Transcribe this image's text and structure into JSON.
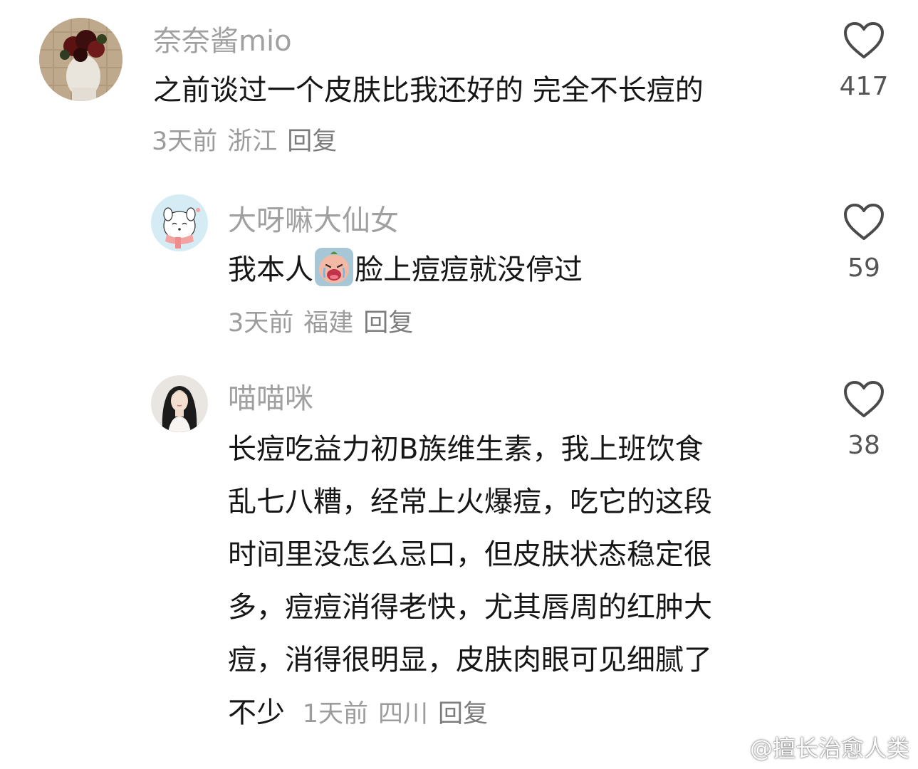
{
  "comments": [
    {
      "username": "奈奈酱mio",
      "text": "之前谈过一个皮肤比我还好的 完全不长痘的",
      "time": "3天前",
      "location": "浙江",
      "reply_label": "回复",
      "likes": "417",
      "avatar_icon": "avatar-bust-statue-with-roses"
    },
    {
      "username": "大呀嘛大仙女",
      "text_before": "我本人",
      "emoji": "crying-face-sticker",
      "text_after": "脸上痘痘就没停过",
      "time": "3天前",
      "location": "福建",
      "reply_label": "回复",
      "likes": "59",
      "avatar_icon": "avatar-white-cartoon-dog-with-scarf"
    },
    {
      "username": "喵喵咪",
      "lines": [
        "长痘吃益力初B族维生素，我上班饮食",
        "乱七八糟，经常上火爆痘，吃它的这段",
        "时间里没怎么忌口，但皮肤状态稳定很",
        "多，痘痘消得老快，尤其唇周的红肿大",
        "痘，消得很明显，皮肤肉眼可见细腻了"
      ],
      "last_line": "不少",
      "time": "1天前",
      "location": "四川",
      "reply_label": "回复",
      "likes": "38",
      "avatar_icon": "avatar-woman-portrait"
    }
  ],
  "watermark": "@擅长治愈人类",
  "colors": {
    "background": "#ffffff",
    "username": "#a0a0a0",
    "text": "#161616",
    "meta": "#9c9c9c"
  }
}
